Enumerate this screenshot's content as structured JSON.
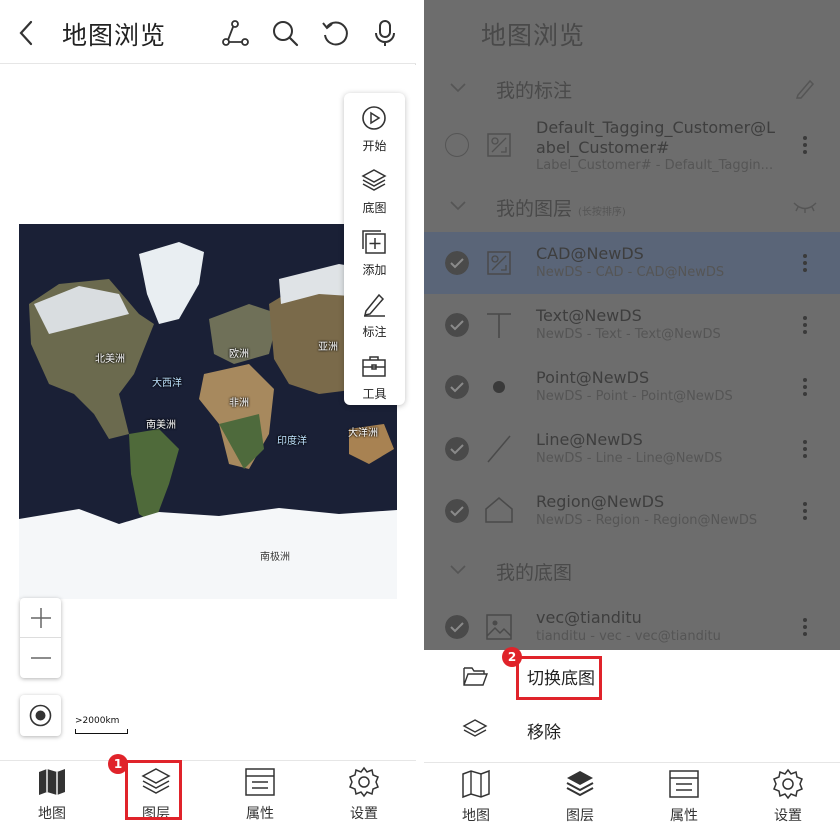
{
  "left": {
    "title": "地图浏览",
    "tools": [
      {
        "label": "开始",
        "icon": "play-icon"
      },
      {
        "label": "底图",
        "icon": "layers-icon"
      },
      {
        "label": "添加",
        "icon": "add-icon"
      },
      {
        "label": "标注",
        "icon": "pen-icon"
      },
      {
        "label": "工具",
        "icon": "toolbox-icon"
      }
    ],
    "map_labels": {
      "north_america": "北美洲",
      "atlantic": "大西洋",
      "europe": "欧洲",
      "asia": "亚洲",
      "africa": "非洲",
      "south_america": "南美洲",
      "indian_ocean": "印度洋",
      "oceania": "大洋洲",
      "antarctica": "南极洲"
    },
    "scale": ">2000km",
    "nav": [
      {
        "label": "地图",
        "icon": "map-icon"
      },
      {
        "label": "图层",
        "icon": "layers-icon"
      },
      {
        "label": "属性",
        "icon": "table-icon"
      },
      {
        "label": "设置",
        "icon": "gear-icon"
      }
    ],
    "step_badge": "1"
  },
  "right": {
    "title": "地图浏览",
    "sections": {
      "my_tags": "我的标注",
      "my_layers": "我的图层",
      "my_layers_hint": "(长按排序)",
      "my_basemap": "我的底图"
    },
    "tag_row": {
      "name_line1": "Default_Tagging_Customer@L",
      "name_line2": "abel_Customer#",
      "sub": "Label_Customer# - Default_Taggin..."
    },
    "layers": [
      {
        "name": "CAD@NewDS",
        "sub": "NewDS - CAD - CAD@NewDS",
        "icon": "cad-icon"
      },
      {
        "name": "Text@NewDS",
        "sub": "NewDS - Text - Text@NewDS",
        "icon": "text-icon"
      },
      {
        "name": "Point@NewDS",
        "sub": "NewDS - Point - Point@NewDS",
        "icon": "point-icon"
      },
      {
        "name": "Line@NewDS",
        "sub": "NewDS - Line - Line@NewDS",
        "icon": "line-icon"
      },
      {
        "name": "Region@NewDS",
        "sub": "NewDS - Region - Region@NewDS",
        "icon": "region-icon"
      }
    ],
    "basemap_row": {
      "name": "vec@tianditu",
      "sub": "tianditu - vec - vec@tianditu"
    },
    "sheet": {
      "switch_label": "切换底图",
      "remove_label": "移除"
    },
    "step_badge": "2",
    "nav": [
      {
        "label": "地图",
        "icon": "map-icon"
      },
      {
        "label": "图层",
        "icon": "layers-icon"
      },
      {
        "label": "属性",
        "icon": "table-icon"
      },
      {
        "label": "设置",
        "icon": "gear-icon"
      }
    ]
  },
  "colors": {
    "highlight": "#e0232a",
    "selected_row": "#5a6578",
    "overlay": "#6d6d6d"
  }
}
